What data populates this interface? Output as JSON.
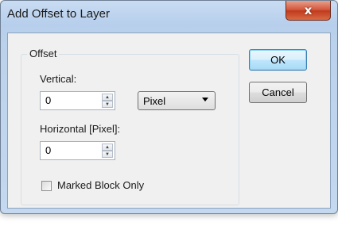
{
  "window": {
    "title": "Add Offset to Layer",
    "close_label": "x"
  },
  "offset_group": {
    "label": "Offset",
    "vertical": {
      "label": "Vertical:",
      "value": "0"
    },
    "unit_select": {
      "selected": "Pixel"
    },
    "horizontal": {
      "label": "Horizontal [Pixel]:",
      "value": "0"
    },
    "marked_block_only": {
      "label": "Marked Block Only",
      "checked": false
    }
  },
  "buttons": {
    "ok": "OK",
    "cancel": "Cancel"
  }
}
